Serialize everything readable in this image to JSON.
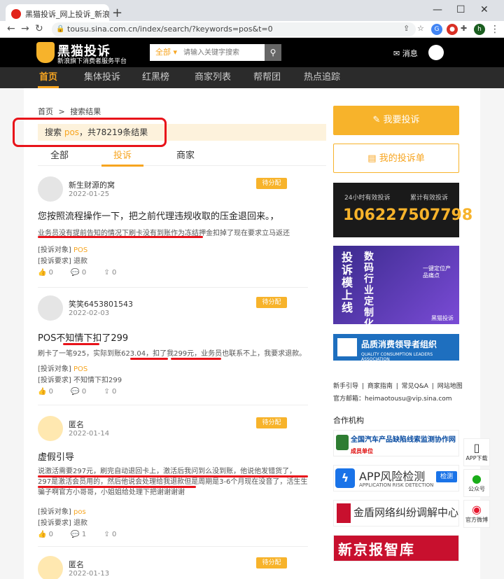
{
  "browser": {
    "tab_title": "黑猫投诉_网上投诉_新浪旗下消费",
    "url": "tousu.sina.com.cn/index/search/?keywords=pos&t=0",
    "profile_initial": "h"
  },
  "header": {
    "logo_title": "黑猫投诉",
    "logo_sub": "新浪旗下消费者服务平台",
    "search_category": "全部 ▾",
    "search_placeholder": "请输入关键字搜索",
    "message_label": "✉ 消息"
  },
  "nav": [
    "首页",
    "集体投诉",
    "红黑榜",
    "商家列表",
    "帮帮团",
    "热点追踪"
  ],
  "breadcrumb": {
    "home": "首页",
    "sep": ">",
    "current": "搜索结果"
  },
  "result": {
    "prefix": "搜索 ",
    "keyword": "pos",
    "suffix": "，共78219条结果"
  },
  "tabs": [
    "全部",
    "投诉",
    "商家"
  ],
  "complaints": [
    {
      "user": "新生财源的窝",
      "date": "2022-01-25",
      "status": "待分配",
      "title": "您按照流程操作一下，把之前代理违规收取的压金退回来。，",
      "desc": "业务员没有提前告知的情况下刷卡没有到账作为冻结押金扣掉了现在要求立马返还",
      "object_label": "[投诉对象]",
      "object": "POS",
      "demand_label": "[投诉要求]",
      "demand": "退款",
      "likes": "0",
      "comments": "0",
      "shares": "0"
    },
    {
      "user": "笑笑6453801543",
      "date": "2022-02-03",
      "status": "待分配",
      "title": "POS不知情下扣了299",
      "desc": "刷卡了一笔925，实际到账623.04，扣了我299元，业务员也联系不上，我要求退款。",
      "object_label": "[投诉对象]",
      "object": "POS",
      "demand_label": "[投诉要求]",
      "demand": "不知情下扣299",
      "likes": "0",
      "comments": "0",
      "shares": "0"
    },
    {
      "user": "匿名",
      "date": "2022-01-14",
      "status": "待分配",
      "title": "虚假引导",
      "desc": "说激活需要297元，刷完自动退回卡上，激活后我问到么没到账，他说他发错货了，297是激活会员用的，然后他说会处理给我退款但是周期是3-6个月现在没音了，活生生骗子啊官方小哥哥，小姐姐给处理下把谢谢谢谢",
      "object_label": "[投诉对象]",
      "object": "pos",
      "demand_label": "[投诉要求]",
      "demand": "退款",
      "likes": "0",
      "comments": "1",
      "shares": "0"
    },
    {
      "user": "匿名",
      "date": "2022-01-13",
      "status": "待分配"
    }
  ],
  "sidebar": {
    "complain_button": "我要投诉",
    "my_complaints_button": "我的投诉单",
    "stat1_label": "24小时有效投诉",
    "stat1_value": "10622",
    "stat2_label": "累计有效投诉",
    "stat2_value": "7507798",
    "banner_t1": "投诉模上线",
    "banner_t2": "数码行业定制化",
    "banner_t3": "一键定位产品痛点",
    "banner_t4": "黑猫投诉",
    "quality_title": "品质消费领导者组织",
    "quality_sub": "QUALITY CONSUMPTION LEADERS ASSOCIATION",
    "links": [
      "新手引导",
      "|",
      "商家指南",
      "|",
      "常见Q&A",
      "|",
      "网站地图"
    ],
    "mail": "官方邮箱：heimaotousu@vip.sina.com",
    "partners_heading": "合作机构",
    "partner1_title": "全国汽车产品缺陷线索监测协作网",
    "partner1_sub": "成员单位",
    "partner2_title": "APP风险检测",
    "partner2_sub": "APPLICATION RISK DETECTION",
    "partner2_btn": "检测",
    "partner3_title": "金盾网络纠纷调解中心",
    "partner4_title": "新京报智库"
  },
  "floating": [
    "APP下载",
    "公众号",
    "官方微博"
  ],
  "colors": {
    "accent": "#f7b32b",
    "annotation": "#e8131a",
    "header_bg": "#000000"
  }
}
